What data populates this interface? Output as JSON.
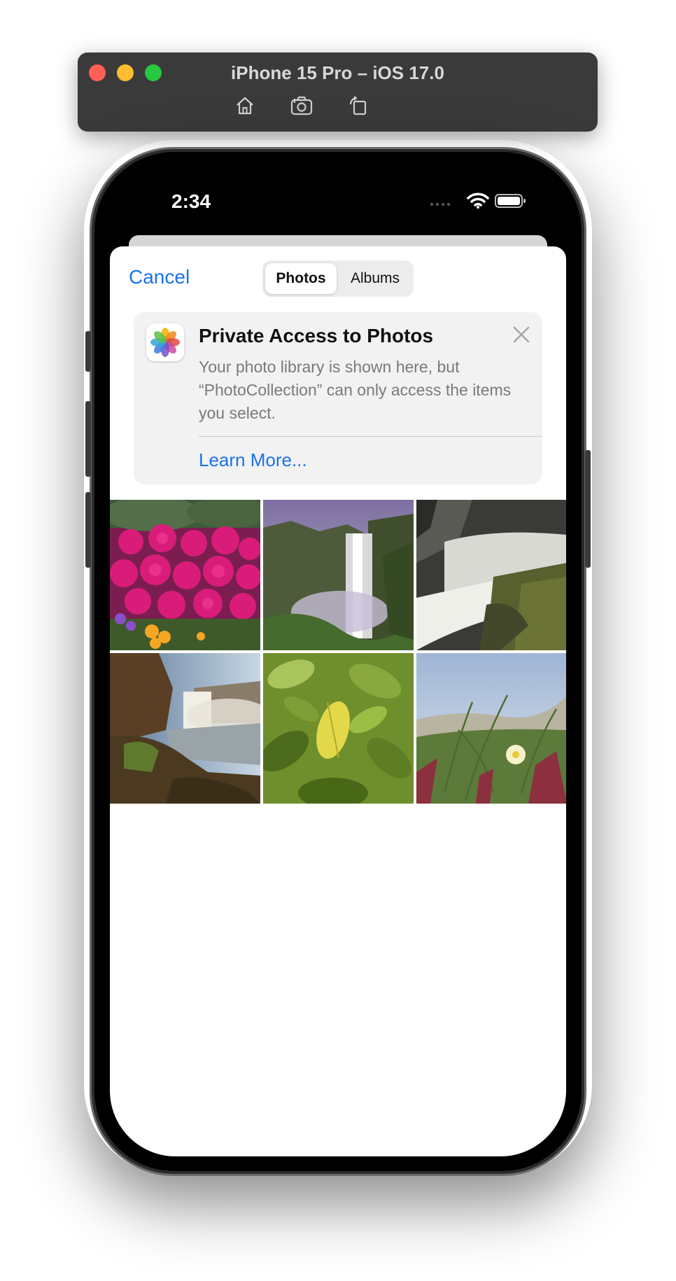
{
  "simulator": {
    "title": "iPhone 15 Pro – iOS 17.0",
    "tools": [
      "home-icon",
      "screenshot-icon",
      "rotate-icon"
    ]
  },
  "status_bar": {
    "time": "2:34",
    "icons": [
      "cellular-icon",
      "wifi-icon",
      "battery-icon"
    ]
  },
  "picker": {
    "cancel_label": "Cancel",
    "tabs": [
      {
        "label": "Photos",
        "selected": true
      },
      {
        "label": "Albums",
        "selected": false
      }
    ]
  },
  "banner": {
    "title": "Private Access to Photos",
    "body": "Your photo library is shown here, but “PhotoCollection” can only access the items you select.",
    "link_label": "Learn More..."
  },
  "photos": [
    {
      "name": "pink-flowers"
    },
    {
      "name": "waterfall-cliff"
    },
    {
      "name": "waterfall-rocks"
    },
    {
      "name": "waterfall-river"
    },
    {
      "name": "green-leaves"
    },
    {
      "name": "dune-flower"
    }
  ],
  "colors": {
    "accent": "#1a73e8",
    "sheet": "#ffffff",
    "banner_bg": "#f2f2f3"
  }
}
